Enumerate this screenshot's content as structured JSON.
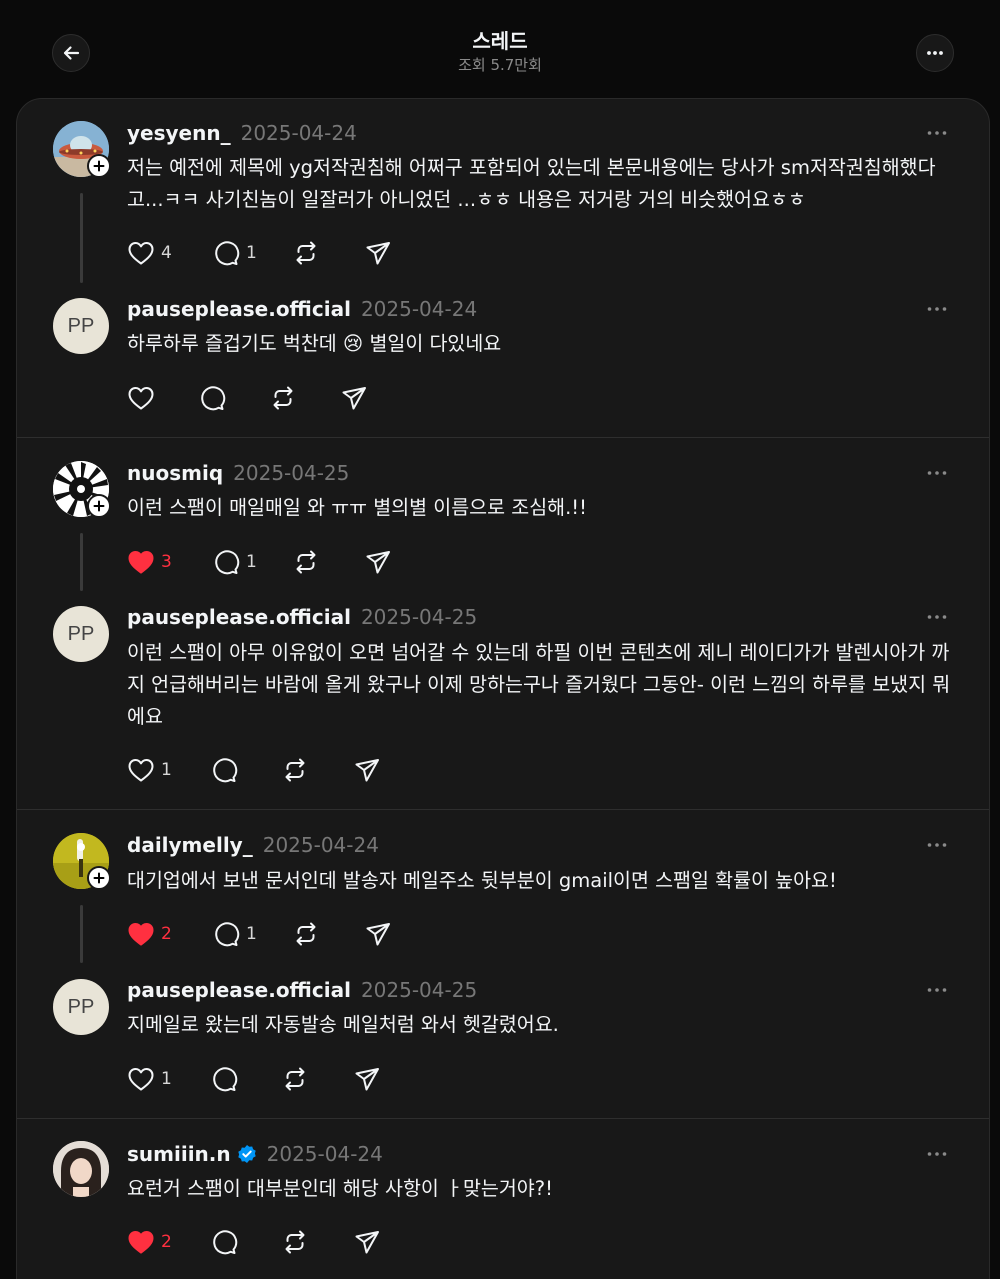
{
  "header": {
    "title": "스레드",
    "views": "조회 5.7만회"
  },
  "posts": [
    {
      "username": "yesyenn_",
      "date": "2025-04-24",
      "text": "저는 예전에 제목에 yg저작권침해 어쩌구 포함되어 있는데 본문내용에는 당사가 sm저작권침해했다고...ㅋㅋ 사기친놈이 일잘러가 아니었던 ...ㅎㅎ 내용은 저거랑 거의 비슷했어요ㅎㅎ",
      "likes": "4",
      "replies": "1",
      "liked": false
    },
    {
      "username": "pauseplease.official",
      "date": "2025-04-24",
      "avatar_initials": "PP",
      "text": "하루하루 즐겁기도 벅찬데 😢 별일이 다있네요",
      "likes": "",
      "replies": "",
      "liked": false
    },
    {
      "username": "nuosmiq",
      "date": "2025-04-25",
      "text": "이런 스팸이 매일매일 와 ㅠㅠ 별의별 이름으로 조심해.!!",
      "likes": "3",
      "replies": "1",
      "liked": true
    },
    {
      "username": "pauseplease.official",
      "date": "2025-04-25",
      "avatar_initials": "PP",
      "text": "이런 스팸이 아무 이유없이 오면 넘어갈 수 있는데 하필 이번 콘텐츠에 제니 레이디가가 발렌시아가 까지 언급해버리는 바람에 올게 왔구나 이제 망하는구나 즐거웠다 그동안- 이런 느낌의 하루를 보냈지 뭐에요",
      "likes": "1",
      "replies": "",
      "liked": false
    },
    {
      "username": "dailymelly_",
      "date": "2025-04-24",
      "text": "대기업에서 보낸 문서인데 발송자 메일주소 뒷부분이 gmail이면 스팸일 확률이 높아요!",
      "likes": "2",
      "replies": "1",
      "liked": true
    },
    {
      "username": "pauseplease.official",
      "date": "2025-04-25",
      "avatar_initials": "PP",
      "text": "지메일로 왔는데 자동발송 메일처럼 와서 헷갈렸어요.",
      "likes": "1",
      "replies": "",
      "liked": false
    },
    {
      "username": "sumiiin.n",
      "date": "2025-04-24",
      "verified": true,
      "text": "요런거 스팸이 대부분인데 해당 사항이 ㅏ맞는거야?!",
      "likes": "2",
      "replies": "",
      "liked": true
    }
  ],
  "icons": {
    "back": "arrow-left-icon",
    "more": "more-horizontal-icon",
    "like": "heart-icon",
    "reply": "comment-icon",
    "repost": "repost-icon",
    "share": "send-icon",
    "verified": "verified-badge-icon"
  },
  "colors": {
    "background": "#0a0a0a",
    "panel": "#181818",
    "liked": "#ff3040",
    "muted": "#777777",
    "verified": "#0095f6"
  }
}
